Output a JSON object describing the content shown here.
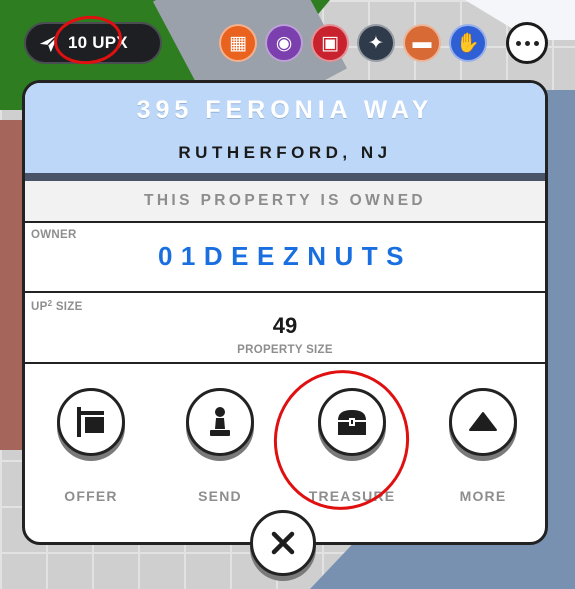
{
  "topbar": {
    "upx_amount": "10 UPX",
    "send_icon": "paper-plane-icon",
    "badges": [
      {
        "name": "orange-bricks-badge",
        "color": "#e9631f",
        "glyph": "▦"
      },
      {
        "name": "purple-camera-badge",
        "color": "#7b3fae",
        "glyph": "◉"
      },
      {
        "name": "red-phone-box-badge",
        "color": "#c9222f",
        "glyph": "▣"
      },
      {
        "name": "zebra-badge",
        "color": "#2f3b4a",
        "glyph": "✦"
      },
      {
        "name": "green-sofa-badge",
        "color": "#d86a35",
        "glyph": "▬"
      },
      {
        "name": "blue-hand-badge",
        "color": "#2f5fd4",
        "glyph": "✋"
      }
    ],
    "more_icon": "ellipsis-icon"
  },
  "property": {
    "street": "395 FERONIA WAY",
    "city": "RUTHERFORD, NJ",
    "status": "THIS PROPERTY IS OWNED",
    "owner_label": "OWNER",
    "owner": "01DEEZNUTS",
    "size_label_prefix": "UP",
    "size_label_sup": "2",
    "size_label_suffix": " SIZE",
    "size_value": "49",
    "size_caption": "PROPERTY SIZE"
  },
  "actions": [
    {
      "label": "OFFER",
      "icon": "sign-board-icon"
    },
    {
      "label": "SEND",
      "icon": "chess-pawn-icon"
    },
    {
      "label": "TREASURE",
      "icon": "treasure-chest-icon"
    },
    {
      "label": "MORE",
      "icon": "triangle-up-icon"
    }
  ],
  "close": {
    "icon": "close-icon"
  },
  "colors": {
    "address_bg": "#bcd7f8",
    "owner_text": "#1a6fe0",
    "annotation": "#e01010",
    "divider": "#4a5468"
  }
}
